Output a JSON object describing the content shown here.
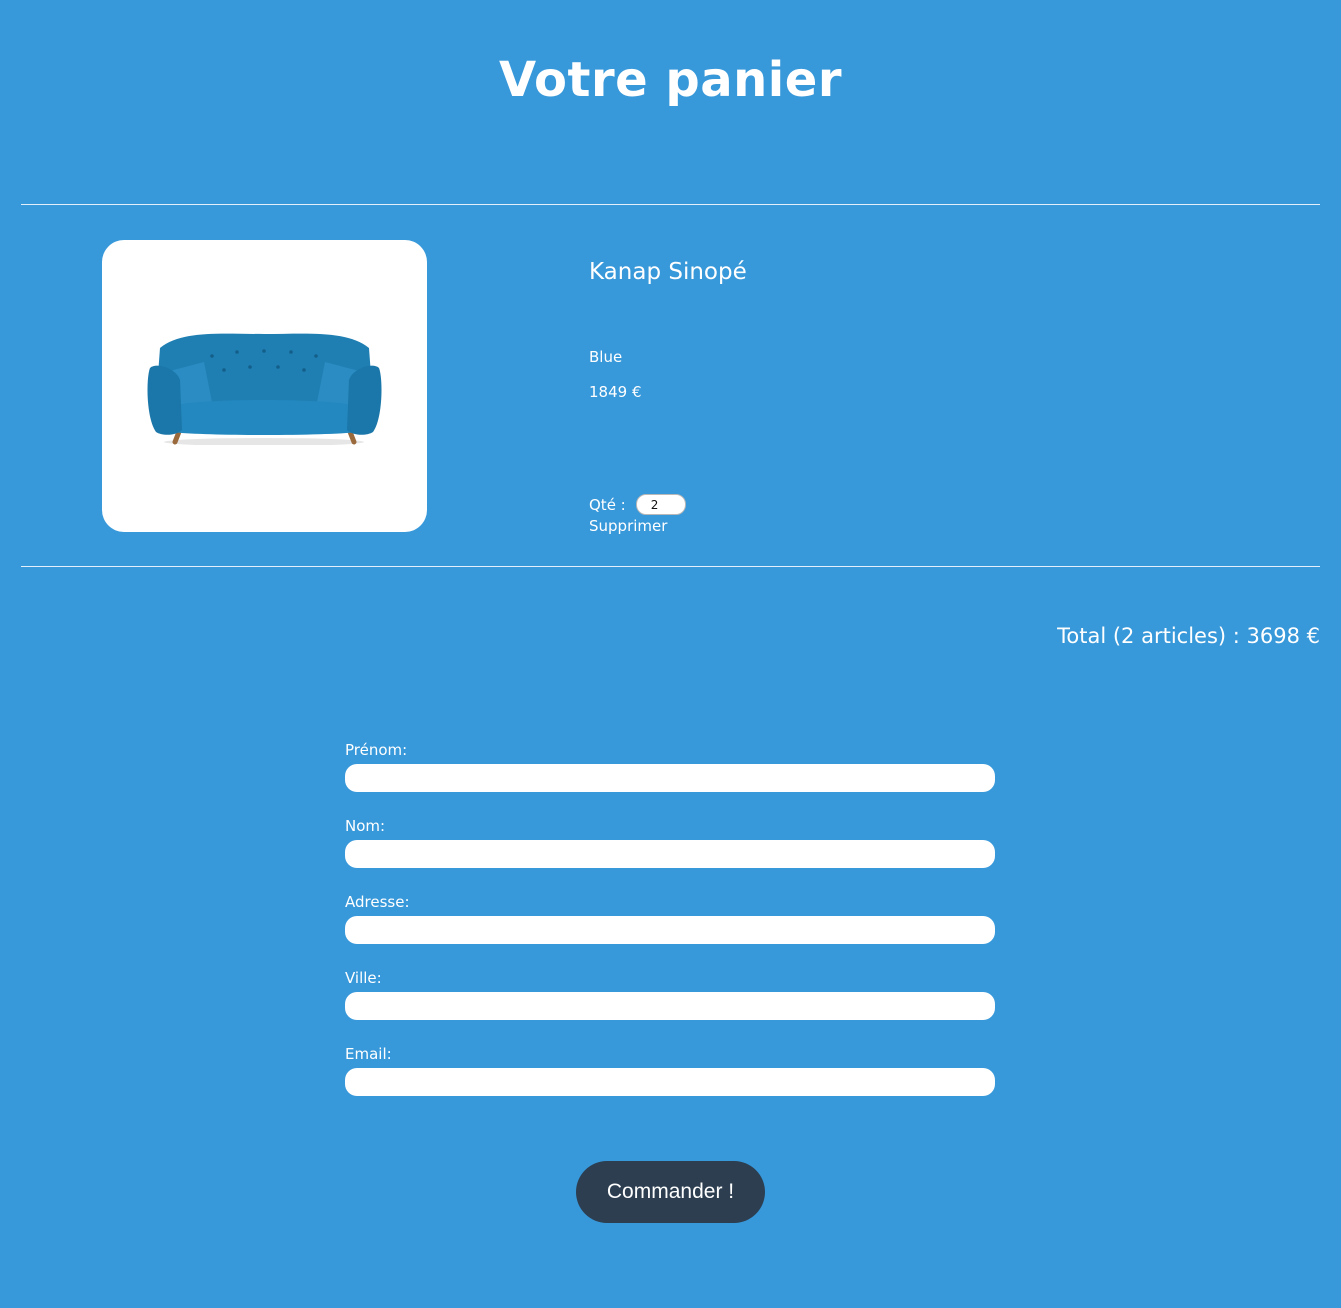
{
  "page": {
    "title": "Votre panier",
    "background_color": "#3798da"
  },
  "cart": {
    "items": [
      {
        "name": "Kanap Sinopé",
        "color": "Blue",
        "price": "1849 €",
        "quantity_label": "Qté :",
        "quantity": "2",
        "delete_label": "Supprimer",
        "image_icon": "sofa-icon"
      }
    ],
    "total_text": "Total (2 articles) : 3698 €"
  },
  "form": {
    "fields": [
      {
        "label": "Prénom:",
        "value": ""
      },
      {
        "label": "Nom:",
        "value": ""
      },
      {
        "label": "Adresse:",
        "value": ""
      },
      {
        "label": "Ville:",
        "value": ""
      },
      {
        "label": "Email:",
        "value": ""
      }
    ],
    "submit_label": "Commander !",
    "submit_color": "#2c3e50"
  }
}
